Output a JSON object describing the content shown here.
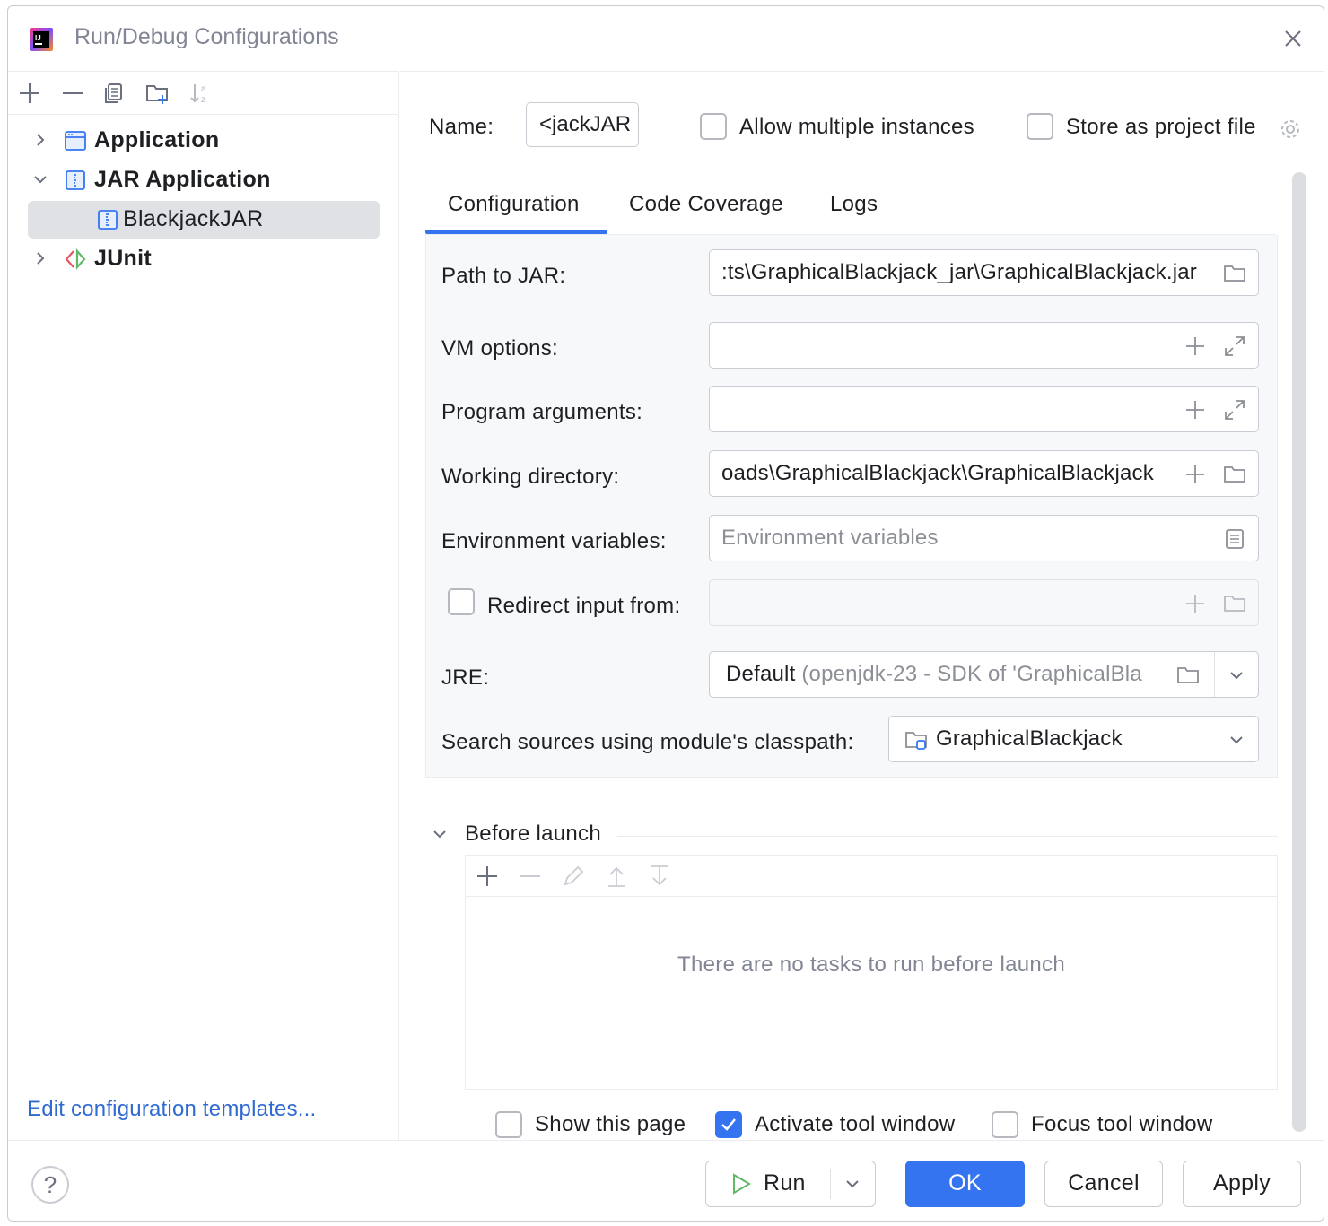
{
  "window": {
    "title": "Run/Debug Configurations"
  },
  "tree": {
    "items": [
      {
        "label": "Application",
        "icon": "application-icon",
        "expanded": false
      },
      {
        "label": "JAR Application",
        "icon": "jar-application-icon",
        "expanded": true
      },
      {
        "label": "BlackjackJAR",
        "icon": "jar-config-icon",
        "selected": true
      },
      {
        "label": "JUnit",
        "icon": "junit-icon",
        "expanded": false
      }
    ],
    "edit_templates": "Edit configuration templates..."
  },
  "header": {
    "name_label": "Name:",
    "name_value": "<jackJAR",
    "allow_multiple": "Allow multiple instances",
    "store_project": "Store as project file"
  },
  "tabs": [
    "Configuration",
    "Code Coverage",
    "Logs"
  ],
  "form": {
    "path_label": "Path to JAR:",
    "path_value": ":ts\\GraphicalBlackjack_jar\\GraphicalBlackjack.jar",
    "vm_label": "VM options:",
    "vm_value": "",
    "args_label": "Program arguments:",
    "args_value": "",
    "workdir_label": "Working directory:",
    "workdir_value": "oads\\GraphicalBlackjack\\GraphicalBlackjack",
    "env_label": "Environment variables:",
    "env_placeholder": "Environment variables",
    "redirect_label": "Redirect input from:",
    "jre_label": "JRE:",
    "jre_value": "Default",
    "jre_detail": "(openjdk-23 - SDK of 'GraphicalBla",
    "module_label": "Search sources using module's classpath:",
    "module_value": "GraphicalBlackjack"
  },
  "before_launch": {
    "title": "Before launch",
    "empty": "There are no tasks to run before launch",
    "show_page": "Show this page",
    "activate_tool": "Activate tool window",
    "focus_tool": "Focus tool window"
  },
  "footer": {
    "help": "?",
    "run": "Run",
    "ok": "OK",
    "cancel": "Cancel",
    "apply": "Apply"
  },
  "colors": {
    "accent": "#3574f0",
    "link": "#2f6ad2",
    "junit_red": "#e55765",
    "junit_green": "#5fb865"
  }
}
